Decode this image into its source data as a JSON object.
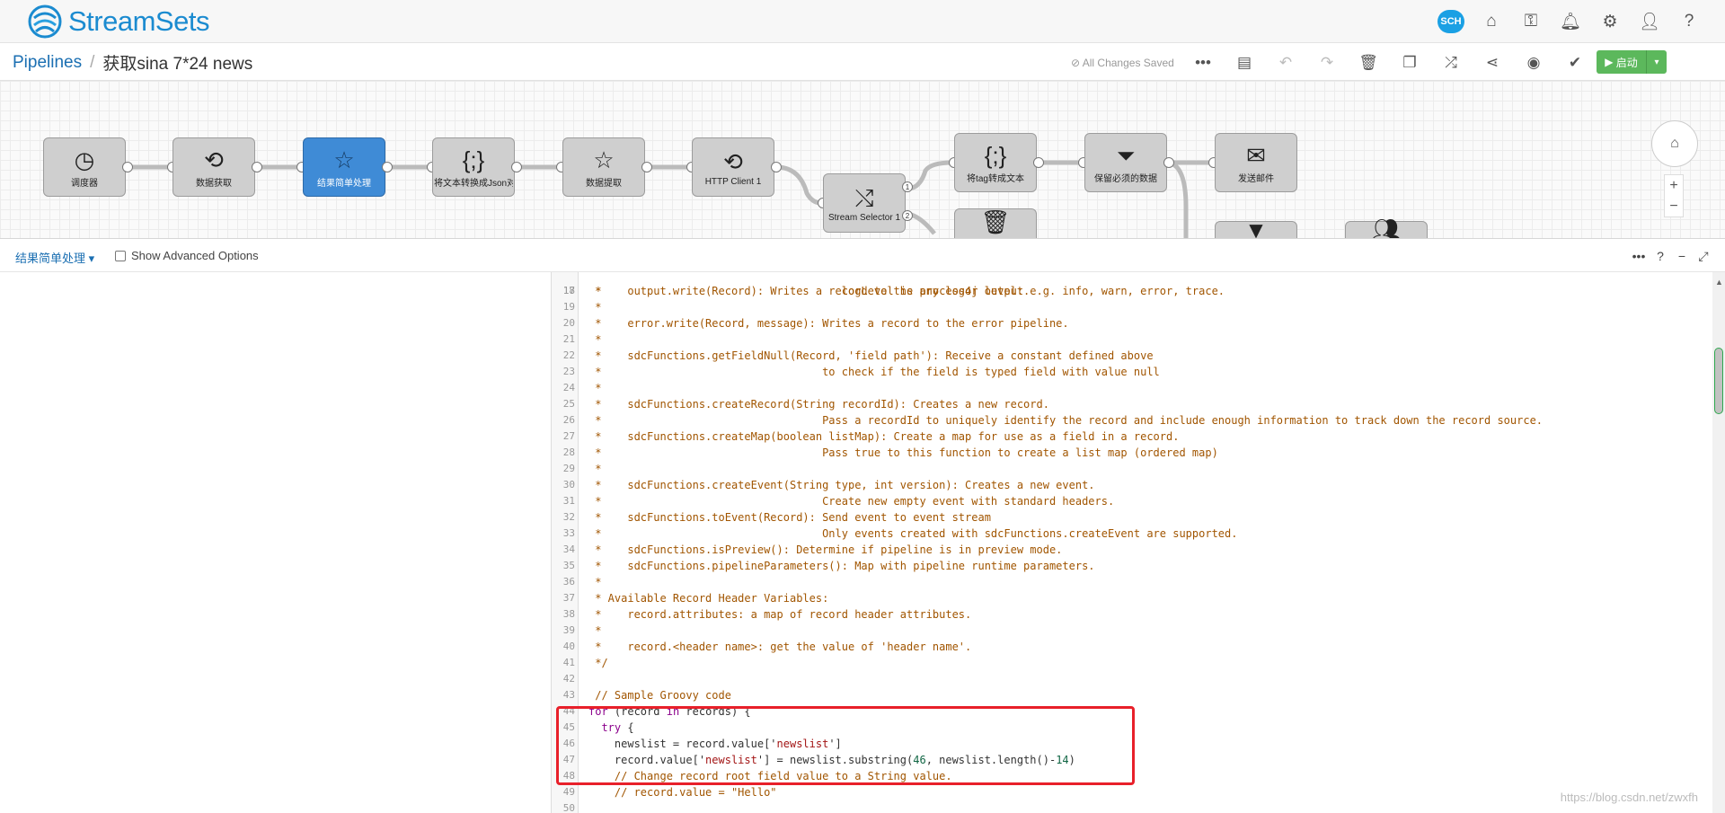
{
  "app": {
    "name": "StreamSets",
    "sch_badge": "SCH"
  },
  "breadcrumb": {
    "root": "Pipelines",
    "separator": "/",
    "pipeline_title": "获取sina 7*24 news"
  },
  "status": {
    "saved": "All Changes Saved"
  },
  "toolbar": {
    "start_label": "启动",
    "more": "•••"
  },
  "pipeline": {
    "nodes": [
      {
        "label": "调度器",
        "icon": "clock-icon"
      },
      {
        "label": "数据获取",
        "icon": "http-client-icon"
      },
      {
        "label": "结果简单处理",
        "icon": "groovy-icon"
      },
      {
        "label": "将文本转换成Json对象",
        "icon": "json-parser-icon"
      },
      {
        "label": "数据提取",
        "icon": "groovy-icon"
      },
      {
        "label": "HTTP Client 1",
        "icon": "http-client-icon"
      },
      {
        "label": "Stream Selector 1",
        "icon": "stream-selector-icon"
      },
      {
        "label": "将tag转成文本",
        "icon": "json-generator-icon"
      },
      {
        "label": "保留必须的数据",
        "icon": "filter-icon"
      },
      {
        "label": "发送邮件",
        "icon": "email-icon"
      },
      {
        "label": "",
        "icon": "trash-icon"
      }
    ],
    "selector_ports": [
      "1",
      "2"
    ]
  },
  "panel": {
    "stage_name": "结果简单处理",
    "advanced_label": "Show Advanced Options"
  },
  "code_lines": [
    {
      "n": "18",
      "t": " *    output.write(Record): Writes a record to the processor output."
    },
    {
      "n": "19",
      "t": " *"
    },
    {
      "n": "20",
      "t": " *    error.write(Record, message): Writes a record to the error pipeline."
    },
    {
      "n": "21",
      "t": " *"
    },
    {
      "n": "22",
      "t": " *    sdcFunctions.getFieldNull(Record, 'field path'): Receive a constant defined above"
    },
    {
      "n": "23",
      "t": " *                                  to check if the field is typed field with value null"
    },
    {
      "n": "24",
      "t": " *"
    },
    {
      "n": "25",
      "t": " *    sdcFunctions.createRecord(String recordId): Creates a new record."
    },
    {
      "n": "26",
      "t": " *                                  Pass a recordId to uniquely identify the record and include enough information to track down the record source."
    },
    {
      "n": "27",
      "t": " *    sdcFunctions.createMap(boolean listMap): Create a map for use as a field in a record."
    },
    {
      "n": "28",
      "t": " *                                  Pass true to this function to create a list map (ordered map)"
    },
    {
      "n": "29",
      "t": " *"
    },
    {
      "n": "30",
      "t": " *    sdcFunctions.createEvent(String type, int version): Creates a new event."
    },
    {
      "n": "31",
      "t": " *                                  Create new empty event with standard headers."
    },
    {
      "n": "32",
      "t": " *    sdcFunctions.toEvent(Record): Send event to event stream"
    },
    {
      "n": "33",
      "t": " *                                  Only events created with sdcFunctions.createEvent are supported."
    },
    {
      "n": "34",
      "t": " *    sdcFunctions.isPreview(): Determine if pipeline is in preview mode."
    },
    {
      "n": "35",
      "t": " *    sdcFunctions.pipelineParameters(): Map with pipeline runtime parameters."
    },
    {
      "n": "36",
      "t": " *"
    },
    {
      "n": "37",
      "t": " * Available Record Header Variables:"
    },
    {
      "n": "38",
      "t": " *    record.attributes: a map of record header attributes."
    },
    {
      "n": "39",
      "t": " *"
    },
    {
      "n": "40",
      "t": " *    record.<header name>: get the value of 'header name'."
    },
    {
      "n": "41",
      "t": " */"
    },
    {
      "n": "42",
      "t": ""
    },
    {
      "n": "43",
      "t": " // Sample Groovy code"
    },
    {
      "n": "44",
      "t": "for (record in records) {"
    },
    {
      "n": "45",
      "t": "  try {"
    },
    {
      "n": "46",
      "t": "    newslist = record.value['newslist']"
    },
    {
      "n": "47",
      "t": "    record.value['newslist'] = newslist.substring(46, newslist.length()-14)"
    },
    {
      "n": "48",
      "t": "    // Change record root field value to a String value."
    },
    {
      "n": "49",
      "t": "    // record.value = \"Hello\""
    },
    {
      "n": "50",
      "t": ""
    }
  ],
  "code_partial_top": " *                                     logLevel is any log4j level: e.g. info, warn, error, trace.",
  "watermark": "https://blog.csdn.net/zwxfh"
}
